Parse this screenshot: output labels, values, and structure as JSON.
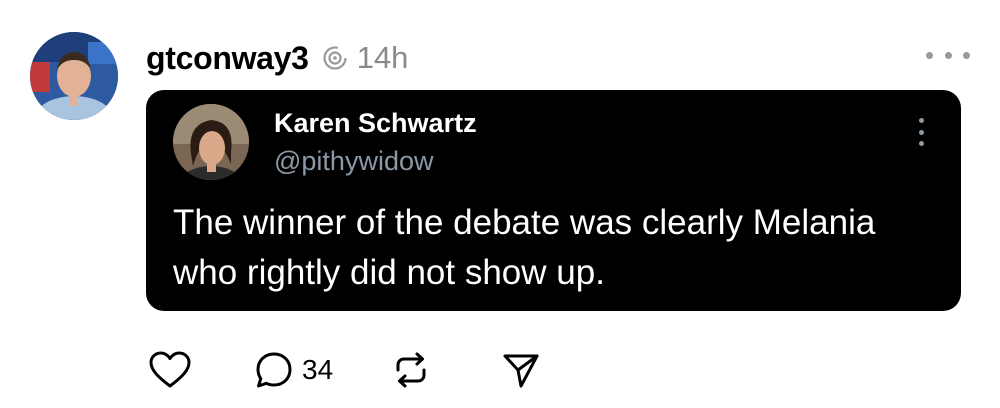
{
  "post": {
    "author": "gtconway3",
    "time": "14h",
    "icons": {
      "author_avatar": "avatar-photo",
      "thread": "threads-icon",
      "more": "more-horizontal-icon"
    }
  },
  "quote": {
    "name": "Karen Schwartz",
    "handle": "@pithywidow",
    "text": "The winner of the debate was clearly Melania who rightly did not show up.",
    "icons": {
      "avatar": "avatar-photo",
      "more": "more-vertical-icon"
    },
    "colors": {
      "background": "#000000",
      "handle": "#8b98a5"
    }
  },
  "actions": {
    "like_icon": "heart-icon",
    "reply_icon": "comment-icon",
    "reply_count": "34",
    "repost_icon": "repost-icon",
    "share_icon": "send-icon"
  }
}
